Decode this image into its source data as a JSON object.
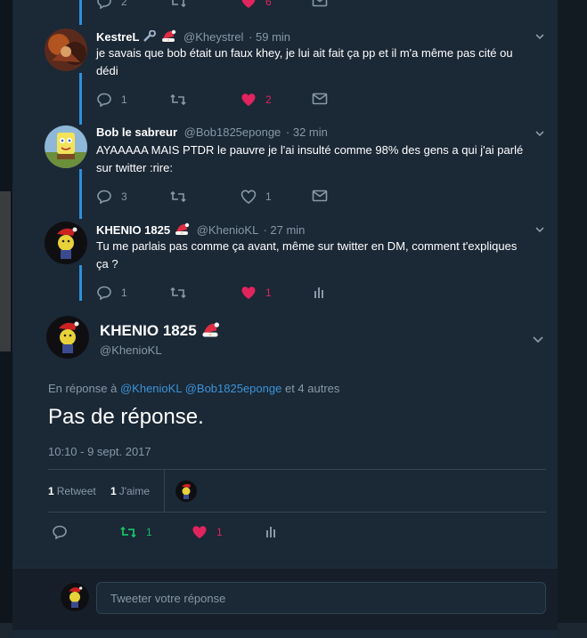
{
  "prev_tweet_actions": {
    "replies": "2",
    "likes": "6"
  },
  "tweets": [
    {
      "name": "KestreL",
      "handle": "@Kheystrel",
      "time": "· 59 min",
      "text": "je savais que bob était un faux khey, je lui ait fait ça pp et il m'a même pas cité ou dédi",
      "replies": "1",
      "likes": "2",
      "liked": true
    },
    {
      "name": "Bob le sabreur",
      "handle": "@Bob1825eponge",
      "time": "· 32 min",
      "text": "AYAAAAA MAIS PTDR le pauvre je l'ai insulté comme 98% des gens a qui j'ai parlé sur twitter :rire:",
      "replies": "3",
      "likes": "1",
      "liked": false
    },
    {
      "name": "KHENIO 1825",
      "handle": "@KhenioKL",
      "time": "· 27 min",
      "text": "Tu me parlais pas comme ça avant, même sur twitter en DM, comment t'expliques ça ?",
      "replies": "1",
      "likes": "1",
      "liked": true
    }
  ],
  "main_tweet": {
    "name": "KHENIO 1825",
    "handle": "@KhenioKL",
    "reply_prefix": "En réponse à",
    "reply_user1": "@KhenioKL",
    "reply_user2": "@Bob1825eponge",
    "reply_suffix": "et 4 autres",
    "text": "Pas de réponse.",
    "timestamp": "10:10 - 9 sept. 2017",
    "retweet_count": "1",
    "retweet_label": "Retweet",
    "like_count": "1",
    "like_label": "J'aime",
    "action_retweets": "1",
    "action_likes": "1"
  },
  "reply_box": {
    "placeholder": "Tweeter votre réponse"
  },
  "colors": {
    "accent": "#2c90d9",
    "like": "#e0245e",
    "retweet": "#17bf63",
    "bg": "#1b2836",
    "muted": "#8899a6"
  },
  "icons": [
    "reply-icon",
    "retweet-icon",
    "heart-icon",
    "mail-icon",
    "analytics-icon",
    "chevron-down-icon",
    "santa-hat-icon",
    "wrench-icon"
  ]
}
